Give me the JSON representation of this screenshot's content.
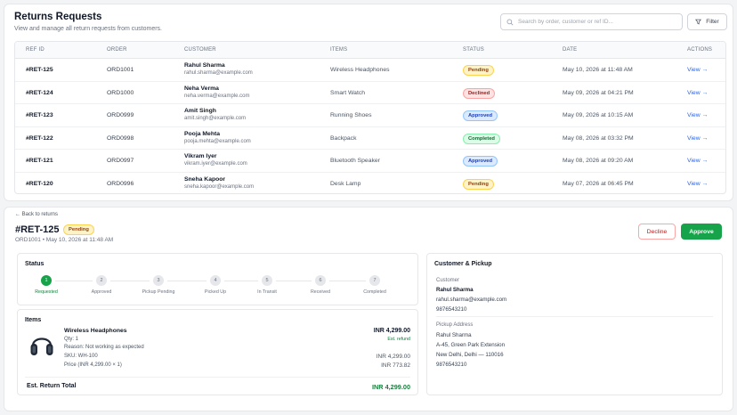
{
  "header": {
    "title": "Returns Requests",
    "subtitle": "View and manage all return requests from customers.",
    "search_placeholder": "Search by order, customer or ref ID...",
    "filter_label": "Filter"
  },
  "table": {
    "columns": [
      "REF ID",
      "ORDER",
      "CUSTOMER",
      "ITEMS",
      "STATUS",
      "DATE",
      "ACTIONS"
    ],
    "rows": [
      {
        "ref": "#RET-125",
        "order": "ORD1001",
        "name": "Rahul Sharma",
        "email": "rahul.sharma@example.com",
        "item": "Wireless Headphones",
        "status": "Pending",
        "date": "May 10, 2026 at 11:48 AM",
        "action": "View →"
      },
      {
        "ref": "#RET-124",
        "order": "ORD1000",
        "name": "Neha Verma",
        "email": "neha.verma@example.com",
        "item": "Smart Watch",
        "status": "Declined",
        "date": "May 09, 2026 at 04:21 PM",
        "action": "View →"
      },
      {
        "ref": "#RET-123",
        "order": "ORD0999",
        "name": "Amit Singh",
        "email": "amit.singh@example.com",
        "item": "Running Shoes",
        "status": "Approved",
        "date": "May 09, 2026 at 10:15 AM",
        "action": "View →"
      },
      {
        "ref": "#RET-122",
        "order": "ORD0998",
        "name": "Pooja Mehta",
        "email": "pooja.mehta@example.com",
        "item": "Backpack",
        "status": "Completed",
        "date": "May 08, 2026 at 03:32 PM",
        "action": "View →"
      },
      {
        "ref": "#RET-121",
        "order": "ORD0997",
        "name": "Vikram Iyer",
        "email": "vikram.iyer@example.com",
        "item": "Bluetooth Speaker",
        "status": "Approved",
        "date": "May 08, 2026 at 09:20 AM",
        "action": "View →"
      },
      {
        "ref": "#RET-120",
        "order": "ORD0996",
        "name": "Sneha Kapoor",
        "email": "sneha.kapoor@example.com",
        "item": "Desk Lamp",
        "status": "Pending",
        "date": "May 07, 2026 at 06:45 PM",
        "action": "View →"
      }
    ]
  },
  "detail": {
    "back_label": "← Back to returns",
    "ref": "#RET-125",
    "status": "Pending",
    "meta": "ORD1001 • May 10, 2026 at 11:48 AM",
    "decline_label": "Decline",
    "approve_label": "Approve",
    "status_section": {
      "title": "Status",
      "steps": [
        {
          "num": "1",
          "label": "Requested"
        },
        {
          "num": "2",
          "label": "Approved"
        },
        {
          "num": "3",
          "label": "Pickup Pending"
        },
        {
          "num": "4",
          "label": "Picked Up"
        },
        {
          "num": "5",
          "label": "In Transit"
        },
        {
          "num": "6",
          "label": "Received"
        },
        {
          "num": "7",
          "label": "Completed"
        }
      ],
      "active_step": 1
    },
    "items_section": {
      "title": "Items",
      "product_name": "Wireless Headphones",
      "qty": "Qty: 1",
      "reason": "Reason: Not working as expected",
      "sku": "SKU: WH-100",
      "price": "Price (INR 4,299.00 × 1)",
      "amount": "INR 4,299.00",
      "refund_note": "Est. refund",
      "line1": "INR 4,299.00",
      "line2": "INR 773.82",
      "total_label": "Est. Return Total",
      "total_value": "INR 4,299.00"
    },
    "customer_section": {
      "title": "Customer & Pickup",
      "customer_label": "Customer",
      "customer_name": "Rahul Sharma",
      "customer_email": "rahul.sharma@example.com",
      "customer_phone": "9876543210",
      "pickup_label": "Pickup Address",
      "pickup_name": "Rahul Sharma",
      "pickup_line1": "A-45, Green Park Extension",
      "pickup_line2": "New Delhi, Delhi — 110016",
      "pickup_phone": "9876543210"
    }
  },
  "colors": {
    "accent_green": "#16a34a",
    "link_blue": "#2563eb",
    "decline_red": "#b91c1c"
  }
}
